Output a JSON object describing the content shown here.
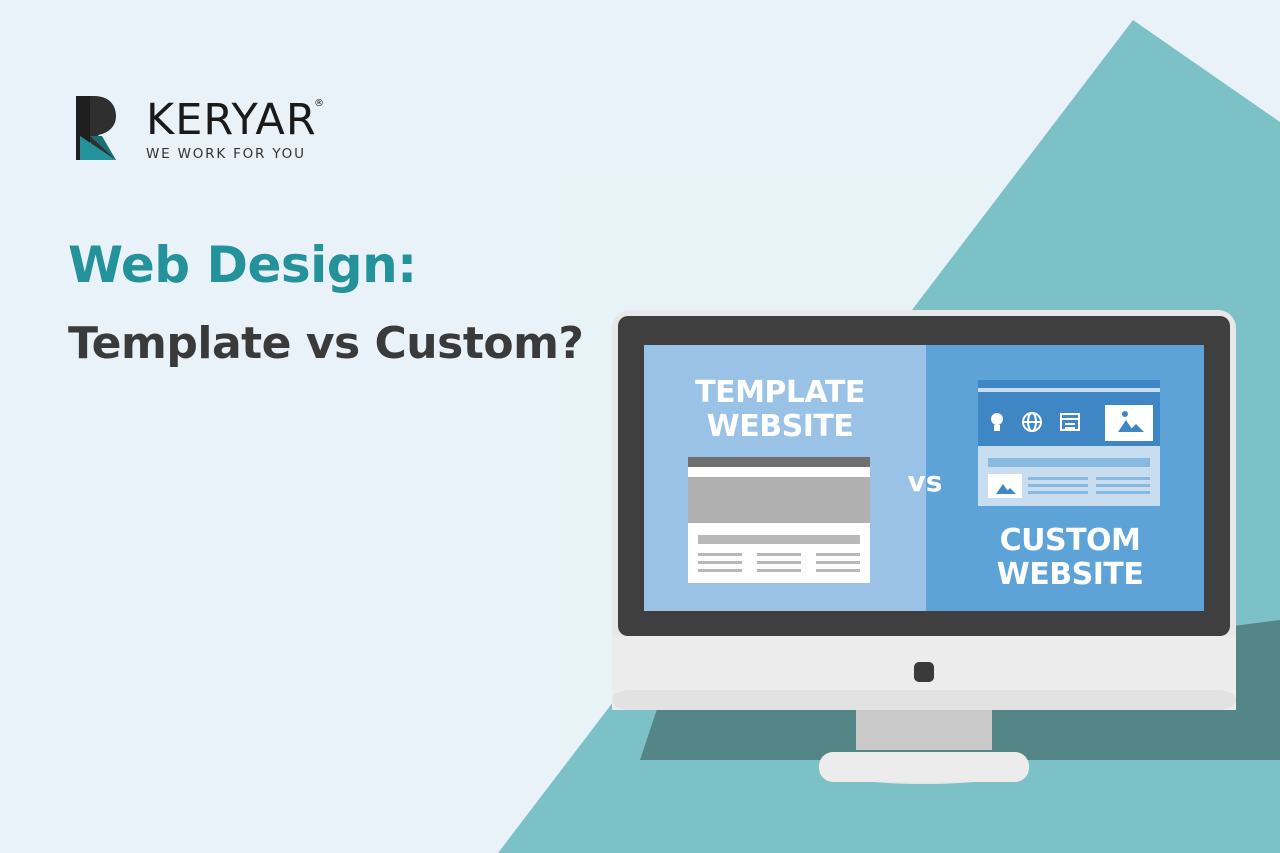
{
  "brand": {
    "name": "KERYAR",
    "registered_mark": "®",
    "tagline": "WE WORK FOR YOU",
    "logo_icon": "keryar-r-logo"
  },
  "headline": {
    "title": "Web Design:",
    "subtitle": "Template vs Custom?"
  },
  "screen": {
    "template_label_line1": "TEMPLATE",
    "template_label_line2": "WEBSITE",
    "vs": "vs",
    "custom_label_line1": "CUSTOM",
    "custom_label_line2": "WEBSITE",
    "custom_icons": [
      "lightbulb-icon",
      "globe-icon",
      "calendar-icon",
      "image-icon"
    ]
  },
  "colors": {
    "background": "#eaf2f9",
    "accent_teal": "#7cc1c6",
    "title_teal": "#23929a",
    "screen_left": "#99c2e6",
    "screen_right": "#5ea3d7"
  }
}
